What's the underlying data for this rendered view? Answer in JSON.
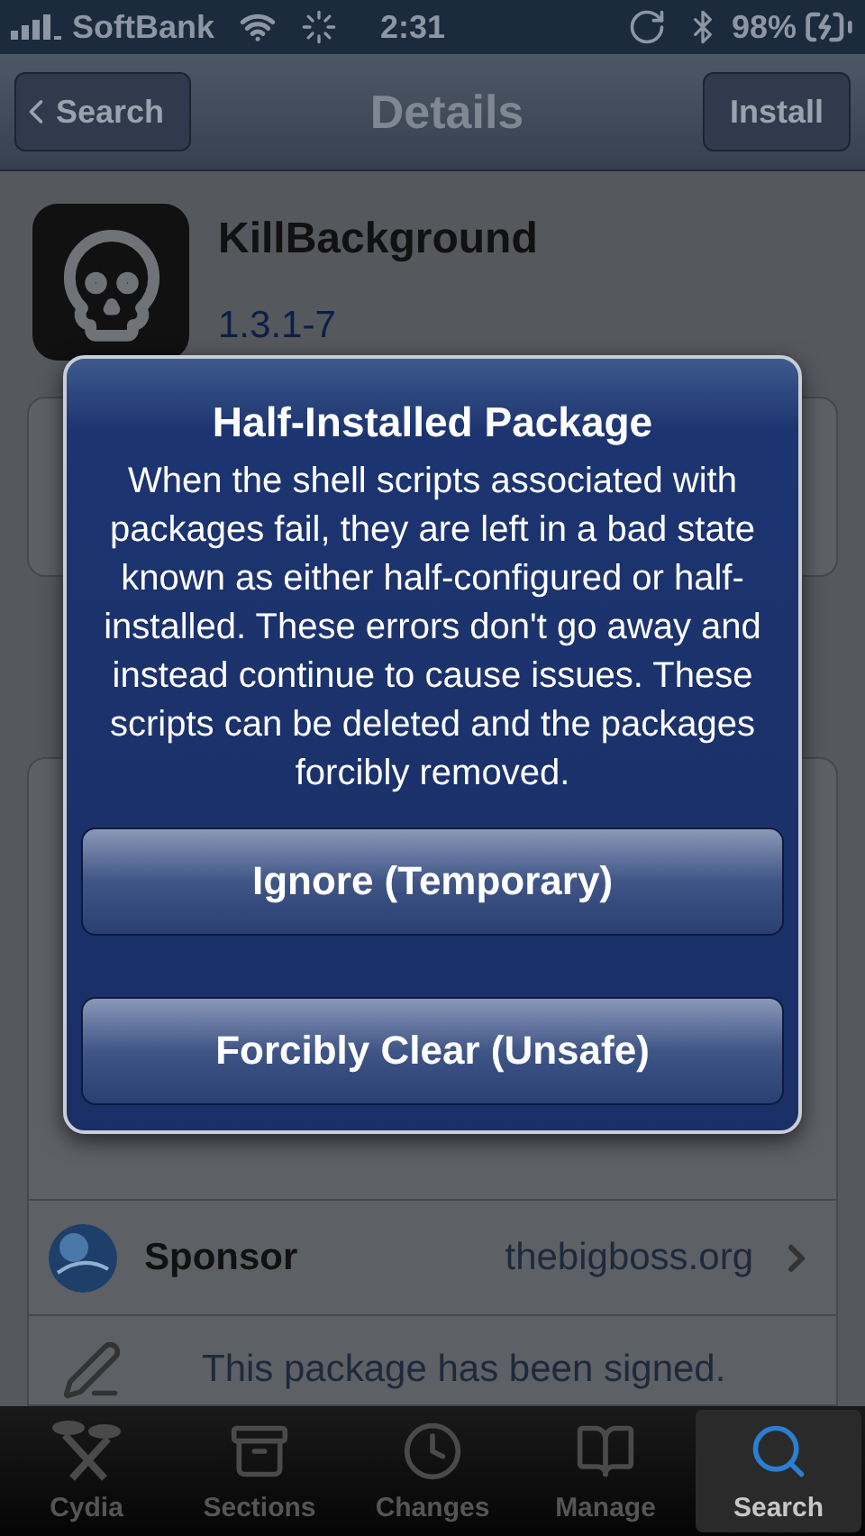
{
  "status_bar": {
    "carrier": "SoftBank",
    "time": "2:31",
    "battery": "98%"
  },
  "nav_bar": {
    "back": "Search",
    "title": "Details",
    "action": "Install"
  },
  "package": {
    "name": "KillBackground",
    "version": "1.3.1-7"
  },
  "rows": [
    {
      "kind": "link",
      "label": "Sponsor",
      "value": "thebigboss.org"
    },
    {
      "kind": "note",
      "label": "This package has been signed."
    }
  ],
  "alert": {
    "title": "Half-Installed Package",
    "message": "When the shell scripts associated with packages fail, they are left in a bad state known as either half-configured or half-installed. These errors don't go away and instead continue to cause issues. These scripts can be deleted and the packages forcibly removed.",
    "buttons": [
      "Ignore (Temporary)",
      "Forcibly Clear (Unsafe)"
    ]
  },
  "tabs": [
    {
      "label": "Cydia",
      "selected": false
    },
    {
      "label": "Sections",
      "selected": false
    },
    {
      "label": "Changes",
      "selected": false
    },
    {
      "label": "Manage",
      "selected": false
    },
    {
      "label": "Search",
      "selected": true
    }
  ]
}
